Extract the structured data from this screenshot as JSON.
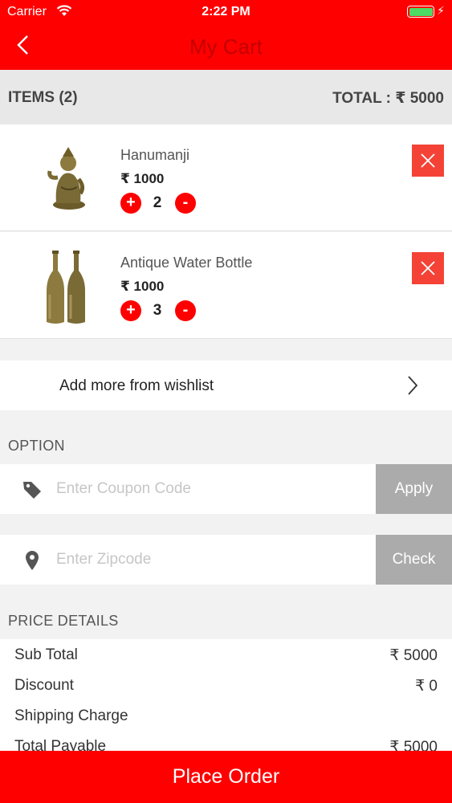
{
  "status_bar": {
    "carrier": "Carrier",
    "time": "2:22 PM"
  },
  "header": {
    "title": "My Cart"
  },
  "summary": {
    "items_label": "ITEMS (2)",
    "total_label": "TOTAL : ₹ 5000"
  },
  "cart_items": [
    {
      "name": "Hanumanji",
      "price": "₹ 1000",
      "quantity": "2",
      "image": "hanuman-statue-image"
    },
    {
      "name": "Antique Water Bottle",
      "price": "₹ 1000",
      "quantity": "3",
      "image": "water-bottles-image"
    }
  ],
  "controls": {
    "plus": "+",
    "minus": "-"
  },
  "wishlist": {
    "label": "Add more from wishlist"
  },
  "option": {
    "title": "OPTION",
    "coupon_placeholder": "Enter Coupon Code",
    "coupon_button": "Apply",
    "zip_placeholder": "Enter Zipcode",
    "zip_button": "Check"
  },
  "price_details": {
    "title": "PRICE DETAILS",
    "rows": [
      {
        "label": "Sub Total",
        "value": "₹ 5000"
      },
      {
        "label": "Discount",
        "value": "₹ 0"
      },
      {
        "label": "Shipping Charge",
        "value": ""
      },
      {
        "label": "Total Payable",
        "value": "₹ 5000"
      }
    ]
  },
  "footer": {
    "place_order": "Place Order"
  },
  "colors": {
    "brand_red": "#ff0000",
    "remove_red": "#f44336",
    "button_gray": "#ababab"
  }
}
